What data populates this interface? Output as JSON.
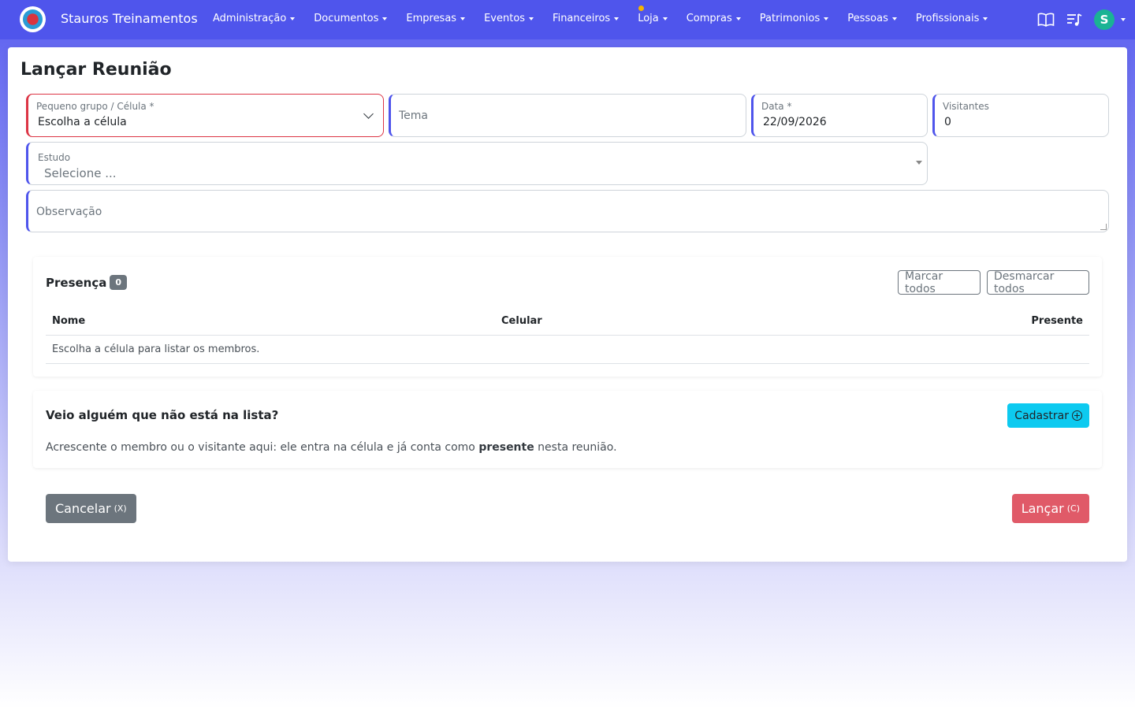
{
  "navbar": {
    "brand": "Stauros Treinamentos",
    "items": [
      {
        "label": "Administração"
      },
      {
        "label": "Documentos"
      },
      {
        "label": "Empresas"
      },
      {
        "label": "Eventos"
      },
      {
        "label": "Financeiros"
      },
      {
        "label": "Loja"
      },
      {
        "label": "Compras"
      },
      {
        "label": "Patrimonios"
      },
      {
        "label": "Pessoas"
      },
      {
        "label": "Profissionais"
      }
    ],
    "avatar_letter": "S",
    "icons": [
      "book-icon",
      "playlist-icon",
      "avatar-icon"
    ]
  },
  "page": {
    "title": "Lançar Reunião"
  },
  "form": {
    "celula_label": "Pequeno grupo / Célula *",
    "celula_value": "Escolha a célula",
    "tema_placeholder": "Tema",
    "data_label": "Data *",
    "data_value": "22/09/2026",
    "visitantes_label": "Visitantes",
    "visitantes_value": "0",
    "estudo_label": "Estudo",
    "estudo_placeholder": "Selecione ...",
    "observacao_placeholder": "Observação"
  },
  "presenca": {
    "title": "Presença",
    "count": "0",
    "marcar_todos": "Marcar todos",
    "desmarcar_todos": "Desmarcar todos",
    "columns": {
      "nome": "Nome",
      "celular": "Celular",
      "presente": "Presente"
    },
    "empty_message": "Escolha a célula para listar os membros."
  },
  "cadastro": {
    "title": "Veio alguém que não está na lista?",
    "button": "Cadastrar",
    "text_before": "Acrescente o membro ou o visitante aqui: ele entra na célula e já conta como ",
    "text_bold": "presente",
    "text_after": " nesta reunião."
  },
  "actions": {
    "cancel_label": "Cancelar",
    "cancel_shortcut": "(X)",
    "submit_label": "Lançar",
    "submit_shortcut": "(C)"
  },
  "colors": {
    "navbar": "#4f55ec",
    "accent": "#4f55ec",
    "danger": "#dc3545",
    "info": "#0dcaf0",
    "secondary": "#6c757d"
  }
}
